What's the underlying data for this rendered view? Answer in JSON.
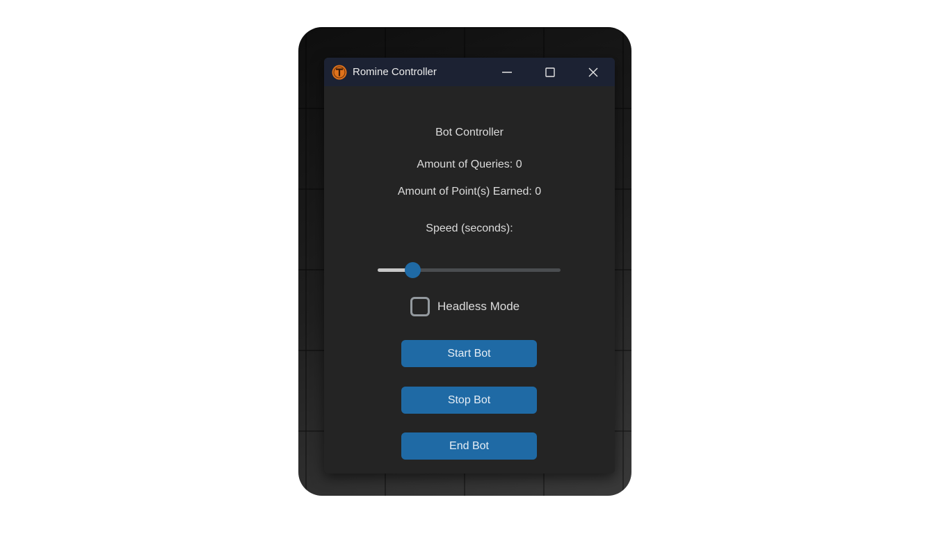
{
  "window": {
    "title": "Romine Controller",
    "icon": "romine-logo-icon",
    "controls": [
      "minimize-icon",
      "maximize-icon",
      "close-icon"
    ]
  },
  "content": {
    "heading": "Bot Controller",
    "queries_label": "Amount of Queries: 0",
    "points_label": "Amount of Point(s) Earned: 0",
    "speed_label": "Speed (seconds):"
  },
  "slider": {
    "fraction": 0.19
  },
  "checkbox": {
    "label": "Headless Mode",
    "checked": false
  },
  "buttons": {
    "start": "Start Bot",
    "stop": "Stop Bot",
    "end": "End Bot"
  },
  "colors": {
    "accent": "#1f6aa5",
    "window_bg": "#242424",
    "titlebar_bg": "#1c2233",
    "icon_orange": "#e0731c"
  }
}
